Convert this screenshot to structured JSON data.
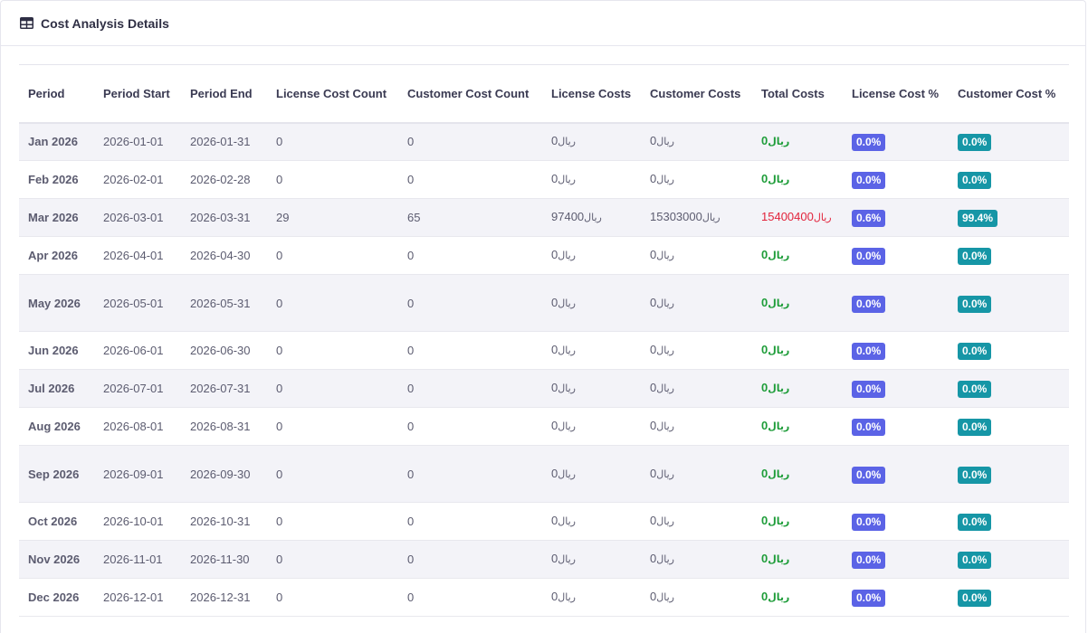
{
  "header": {
    "title": "Cost Analysis Details",
    "icon": "table-icon"
  },
  "colors": {
    "accent_badge": "#5b63e6",
    "customer_badge": "#1696a6",
    "total_green": "#1f9d3a",
    "total_red": "#e2233b"
  },
  "currency_symbol": "ريال",
  "columns": [
    "Period",
    "Period Start",
    "Period End",
    "License Cost Count",
    "Customer Cost Count",
    "License Costs",
    "Customer Costs",
    "Total Costs",
    "License Cost %",
    "Customer Cost %"
  ],
  "rows": [
    {
      "period": "Jan 2026",
      "start": "2026-01-01",
      "end": "2026-01-31",
      "lic_count": "0",
      "cus_count": "0",
      "lic_costs": "0",
      "cus_costs": "0",
      "total": "0",
      "lic_pct": "0.0%",
      "cus_pct": "0.0%"
    },
    {
      "period": "Feb 2026",
      "start": "2026-02-01",
      "end": "2026-02-28",
      "lic_count": "0",
      "cus_count": "0",
      "lic_costs": "0",
      "cus_costs": "0",
      "total": "0",
      "lic_pct": "0.0%",
      "cus_pct": "0.0%"
    },
    {
      "period": "Mar 2026",
      "start": "2026-03-01",
      "end": "2026-03-31",
      "lic_count": "29",
      "cus_count": "65",
      "lic_costs": "97400",
      "cus_costs": "15303000",
      "total": "15400400",
      "lic_pct": "0.6%",
      "cus_pct": "99.4%"
    },
    {
      "period": "Apr 2026",
      "start": "2026-04-01",
      "end": "2026-04-30",
      "lic_count": "0",
      "cus_count": "0",
      "lic_costs": "0",
      "cus_costs": "0",
      "total": "0",
      "lic_pct": "0.0%",
      "cus_pct": "0.0%"
    },
    {
      "period": "May 2026",
      "start": "2026-05-01",
      "end": "2026-05-31",
      "lic_count": "0",
      "cus_count": "0",
      "lic_costs": "0",
      "cus_costs": "0",
      "total": "0",
      "lic_pct": "0.0%",
      "cus_pct": "0.0%"
    },
    {
      "period": "Jun 2026",
      "start": "2026-06-01",
      "end": "2026-06-30",
      "lic_count": "0",
      "cus_count": "0",
      "lic_costs": "0",
      "cus_costs": "0",
      "total": "0",
      "lic_pct": "0.0%",
      "cus_pct": "0.0%"
    },
    {
      "period": "Jul 2026",
      "start": "2026-07-01",
      "end": "2026-07-31",
      "lic_count": "0",
      "cus_count": "0",
      "lic_costs": "0",
      "cus_costs": "0",
      "total": "0",
      "lic_pct": "0.0%",
      "cus_pct": "0.0%"
    },
    {
      "period": "Aug 2026",
      "start": "2026-08-01",
      "end": "2026-08-31",
      "lic_count": "0",
      "cus_count": "0",
      "lic_costs": "0",
      "cus_costs": "0",
      "total": "0",
      "lic_pct": "0.0%",
      "cus_pct": "0.0%"
    },
    {
      "period": "Sep 2026",
      "start": "2026-09-01",
      "end": "2026-09-30",
      "lic_count": "0",
      "cus_count": "0",
      "lic_costs": "0",
      "cus_costs": "0",
      "total": "0",
      "lic_pct": "0.0%",
      "cus_pct": "0.0%"
    },
    {
      "period": "Oct 2026",
      "start": "2026-10-01",
      "end": "2026-10-31",
      "lic_count": "0",
      "cus_count": "0",
      "lic_costs": "0",
      "cus_costs": "0",
      "total": "0",
      "lic_pct": "0.0%",
      "cus_pct": "0.0%"
    },
    {
      "period": "Nov 2026",
      "start": "2026-11-01",
      "end": "2026-11-30",
      "lic_count": "0",
      "cus_count": "0",
      "lic_costs": "0",
      "cus_costs": "0",
      "total": "0",
      "lic_pct": "0.0%",
      "cus_pct": "0.0%"
    },
    {
      "period": "Dec 2026",
      "start": "2026-12-01",
      "end": "2026-12-31",
      "lic_count": "0",
      "cus_count": "0",
      "lic_costs": "0",
      "cus_costs": "0",
      "total": "0",
      "lic_pct": "0.0%",
      "cus_pct": "0.0%"
    }
  ]
}
